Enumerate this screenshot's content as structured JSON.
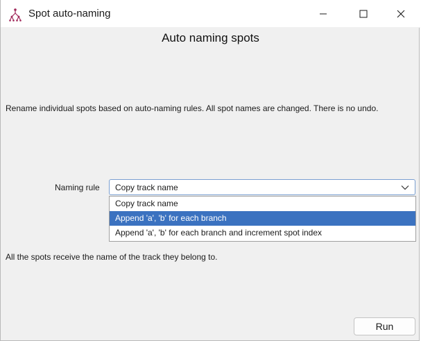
{
  "window": {
    "title": "Spot auto-naming",
    "app_icon": "track-tree-icon",
    "controls": [
      "minimize-icon",
      "maximize-icon",
      "close-icon"
    ]
  },
  "main": {
    "heading": "Auto naming spots",
    "description": "Rename individual spots based on auto-naming rules. All spot names are changed. There is no undo.",
    "naming_rule": {
      "label": "Naming rule",
      "selected_value": "Copy track name",
      "options": [
        "Copy track name",
        "Append 'a', 'b' for each branch",
        "Append 'a', 'b' for each branch and increment spot index"
      ],
      "highlighted_option": "Append 'a', 'b' for each branch"
    },
    "info": "All the spots receive the name of the track they belong to.",
    "run_label": "Run"
  },
  "colors": {
    "highlight": "#3b72c0",
    "app_icon": "#a0285a"
  }
}
